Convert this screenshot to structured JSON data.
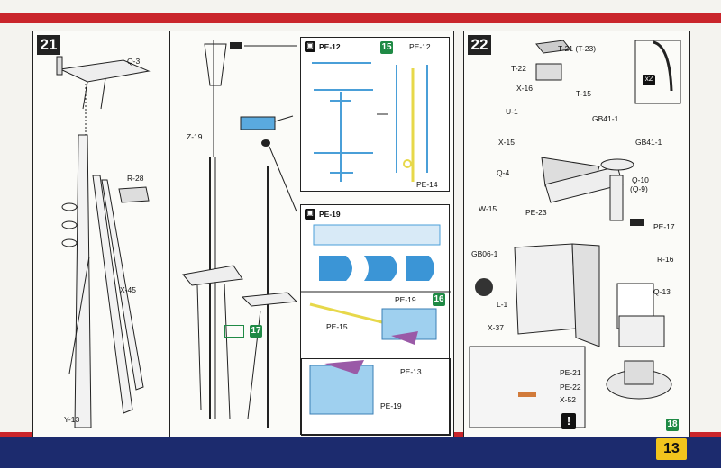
{
  "page_number": "13",
  "step21": {
    "number": "21",
    "labels": {
      "q3": "Q-3",
      "r28": "R-28",
      "x45": "X-45",
      "y13": "Y-13",
      "z19": "Z-19"
    },
    "sub_step": "17"
  },
  "box_pe12": {
    "part": "PE-12",
    "step": "15",
    "part_right": "PE-12",
    "part_pe14": "PE-14"
  },
  "box_pe19": {
    "part": "PE-19",
    "part_19b": "PE-19",
    "step": "16",
    "pe15": "PE-15",
    "pe13": "PE-13",
    "pe19c": "PE-19"
  },
  "step22": {
    "number": "22",
    "labels": {
      "t21": "T-21 (T-23)",
      "t22": "T-22",
      "x16": "X-16",
      "t15": "T-15",
      "u1": "U-1",
      "gb41a": "GB41-1",
      "x15": "X-15",
      "gb41b": "GB41-1",
      "q4": "Q-4",
      "q10": "Q-10",
      "q9": "(Q-9)",
      "w15": "W-15",
      "pe23": "PE-23",
      "pe17": "PE-17",
      "gb06": "GB06-1",
      "r16": "R-16",
      "l1": "L-1",
      "q13": "Q-13",
      "x37": "X-37",
      "pe21": "PE-21",
      "pe22": "PE-22",
      "x52": "X-52",
      "x2": "x2"
    },
    "sub_step": "18"
  }
}
